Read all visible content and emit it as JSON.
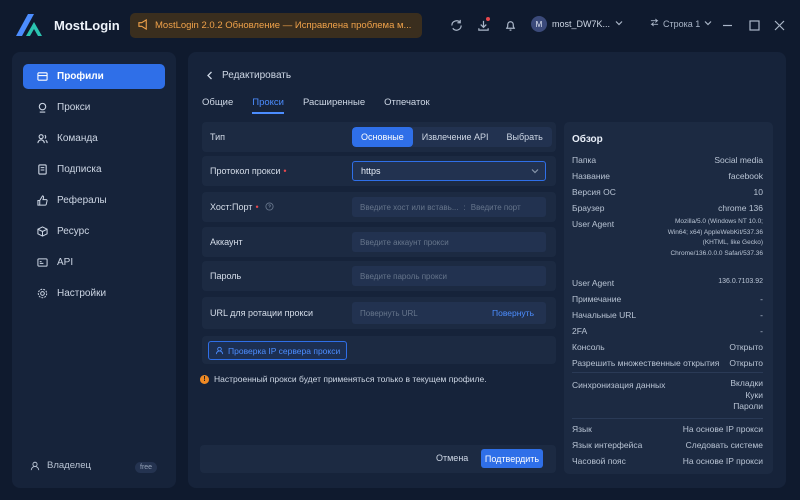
{
  "header": {
    "app_name": "MostLogin",
    "notice": "MostLogin 2.0.2 Обновление — Исправлена проблема м...",
    "username": "most_DW7K...",
    "avatar_letter": "M",
    "row_selector": "Строка 1"
  },
  "sidebar": {
    "items": [
      {
        "label": "Профили",
        "icon": "profiles-icon"
      },
      {
        "label": "Прокси",
        "icon": "proxy-icon"
      },
      {
        "label": "Команда",
        "icon": "team-icon"
      },
      {
        "label": "Подписка",
        "icon": "subscription-icon"
      },
      {
        "label": "Рефералы",
        "icon": "referrals-icon"
      },
      {
        "label": "Ресурс",
        "icon": "resource-icon"
      },
      {
        "label": "API",
        "icon": "api-icon"
      },
      {
        "label": "Настройки",
        "icon": "settings-icon"
      }
    ],
    "owner": "Владелец",
    "plan": "free"
  },
  "page": {
    "back_title": "Редактировать",
    "tabs": [
      "Общие",
      "Прокси",
      "Расширенные",
      "Отпечаток"
    ],
    "active_tab": "Прокси"
  },
  "form": {
    "type_label": "Тип",
    "type_options": [
      "Основные",
      "Извлечение API",
      "Выбрать"
    ],
    "protocol_label": "Протокол прокси",
    "protocol_value": "https",
    "host_label": "Хост:Порт",
    "host_placeholder": "Введите хост или вставь...",
    "port_placeholder": "Введите порт",
    "account_label": "Аккаунт",
    "account_placeholder": "Введите аккаунт прокси",
    "password_label": "Пароль",
    "password_placeholder": "Введите пароль прокси",
    "rotation_label": "URL для ротации прокси",
    "rotation_placeholder": "Повернуть URL",
    "rotation_action": "Повернуть",
    "check_button": "Проверка IP сервера прокси",
    "warning": "Настроенный прокси будет применяться только в текущем профиле.",
    "cancel": "Отмена",
    "confirm": "Подтвердить"
  },
  "overview": {
    "title": "Обзор",
    "rows": [
      {
        "k": "Папка",
        "v": "Social media"
      },
      {
        "k": "Название",
        "v": "facebook"
      },
      {
        "k": "Версия ОС",
        "v": "10"
      },
      {
        "k": "Браузер",
        "v": "chrome  136"
      }
    ],
    "ua_label": "User Agent",
    "ua_value": "Mozilla/5.0 (Windows NT 10.0; Win64; x64) AppleWebKit/537.36 (KHTML, like Gecko) Chrome/136.0.0.0 Safari/537.36",
    "rows2": [
      {
        "k": "User Agent",
        "v": "136.0.7103.92"
      },
      {
        "k": "Примечание",
        "v": "-"
      },
      {
        "k": "Начальные URL",
        "v": "-"
      },
      {
        "k": "2FA",
        "v": "-"
      },
      {
        "k": "Консоль",
        "v": "Открыто"
      },
      {
        "k": "Разрешить множественные открытия",
        "v": "Открыто"
      }
    ],
    "sync_label": "Синхронизация данных",
    "sync_values": [
      "Вкладки",
      "Куки",
      "Пароли"
    ],
    "rows3": [
      {
        "k": "Язык",
        "v": "На основе IP прокси"
      },
      {
        "k": "Язык интерфейса",
        "v": "Следовать системе"
      },
      {
        "k": "Часовой пояс",
        "v": "На основе IP прокси"
      }
    ]
  },
  "colors": {
    "accent": "#2f6fe8",
    "warning": "#f08a24",
    "background": "#0f1a2e",
    "panel": "#16233a"
  }
}
